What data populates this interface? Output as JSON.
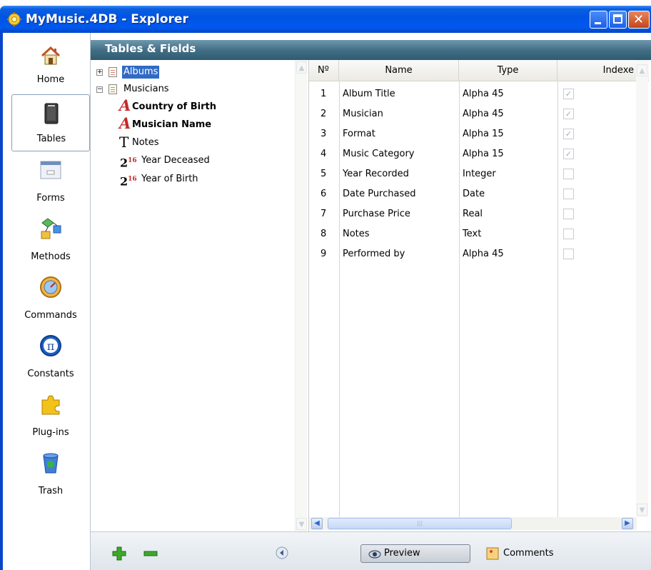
{
  "window": {
    "title": "MyMusic.4DB - Explorer",
    "minimize_label": "_",
    "maximize_label": "□",
    "close_label": "✕"
  },
  "nav": {
    "items": [
      {
        "label": "Home",
        "icon": "home-icon"
      },
      {
        "label": "Tables",
        "icon": "tables-icon",
        "selected": true
      },
      {
        "label": "Forms",
        "icon": "forms-icon"
      },
      {
        "label": "Methods",
        "icon": "methods-icon"
      },
      {
        "label": "Commands",
        "icon": "commands-icon"
      },
      {
        "label": "Constants",
        "icon": "constants-icon"
      },
      {
        "label": "Plug-ins",
        "icon": "plugins-icon"
      },
      {
        "label": "Trash",
        "icon": "trash-icon"
      }
    ]
  },
  "header": {
    "title": "Tables & Fields"
  },
  "tree": {
    "tables": [
      {
        "name": "Albums",
        "expanded": false,
        "selected": true
      },
      {
        "name": "Musicians",
        "expanded": true,
        "fields": [
          {
            "name": "Country of Birth",
            "type_icon": "alpha-icon",
            "bold": true
          },
          {
            "name": "Musician Name",
            "type_icon": "alpha-icon",
            "bold": true
          },
          {
            "name": "Notes",
            "type_icon": "text-icon",
            "bold": false
          },
          {
            "name": "Year Deceased",
            "type_icon": "integer-icon",
            "bold": false
          },
          {
            "name": "Year of Birth",
            "type_icon": "integer-icon",
            "bold": false
          }
        ]
      }
    ],
    "integer_glyph": "2",
    "integer_sup": "16",
    "alpha_glyph": "A",
    "text_glyph": "T"
  },
  "grid": {
    "columns": [
      "Nº",
      "Name",
      "Type",
      "Indexe"
    ],
    "rows": [
      {
        "no": "1",
        "name": "Album Title",
        "type": "Alpha 45",
        "indexed": true
      },
      {
        "no": "2",
        "name": "Musician",
        "type": "Alpha 45",
        "indexed": true
      },
      {
        "no": "3",
        "name": "Format",
        "type": "Alpha 15",
        "indexed": true
      },
      {
        "no": "4",
        "name": "Music Category",
        "type": "Alpha 15",
        "indexed": true
      },
      {
        "no": "5",
        "name": "Year Recorded",
        "type": "Integer",
        "indexed": false
      },
      {
        "no": "6",
        "name": "Date Purchased",
        "type": "Date",
        "indexed": false
      },
      {
        "no": "7",
        "name": "Purchase Price",
        "type": "Real",
        "indexed": false
      },
      {
        "no": "8",
        "name": "Notes",
        "type": "Text",
        "indexed": false
      },
      {
        "no": "9",
        "name": "Performed by",
        "type": "Alpha 45",
        "indexed": false
      }
    ]
  },
  "bottom": {
    "add_label": "+",
    "remove_label": "−",
    "preview_label": "Preview",
    "comments_label": "Comments"
  },
  "colors": {
    "titlebar": "#0054e3",
    "header": "#436f86",
    "selection": "#316ac5"
  }
}
